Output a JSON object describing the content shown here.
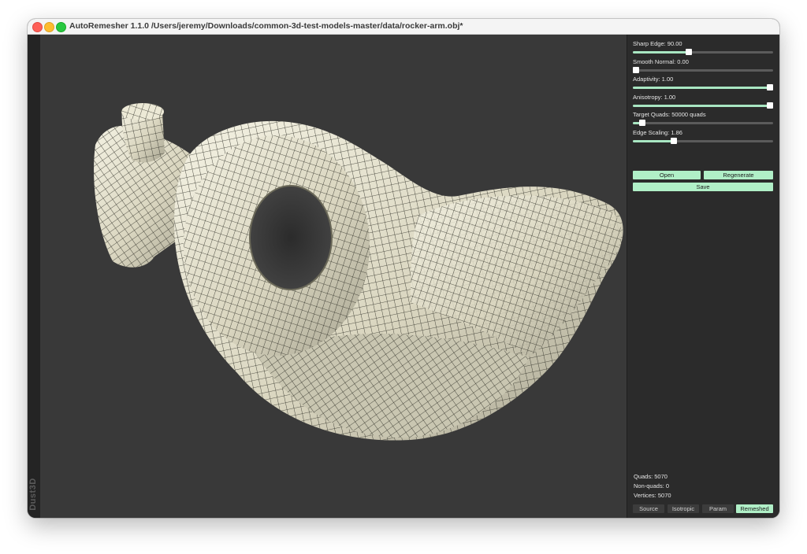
{
  "window": {
    "title": "AutoRemesher 1.1.0 /Users/jeremy/Downloads/common-3d-test-models-master/data/rocker-arm.obj*",
    "brand": "Dust3D"
  },
  "params": [
    {
      "label": "Sharp Edge: 90.00",
      "value": 0.4
    },
    {
      "label": "Smooth Normal: 0.00",
      "value": 0.0
    },
    {
      "label": "Adaptivity: 1.00",
      "value": 1.0
    },
    {
      "label": "Anisotropy: 1.00",
      "value": 1.0
    },
    {
      "label": "Target Quads: 50000 quads",
      "value": 0.07
    },
    {
      "label": "Edge Scaling: 1.86",
      "value": 0.29
    }
  ],
  "buttons": {
    "open": "Open",
    "regenerate": "Regenerate",
    "save": "Save"
  },
  "stats": {
    "quads": "Quads: 5070",
    "nonquads": "Non-quads: 0",
    "vertices": "Vertices: 5070"
  },
  "tabs": [
    {
      "label": "Source",
      "active": false
    },
    {
      "label": "Isotropic",
      "active": false
    },
    {
      "label": "Param",
      "active": false
    },
    {
      "label": "Remeshed",
      "active": true
    }
  ],
  "colors": {
    "accent": "#b0efc7",
    "mesh": "#e9e6d2",
    "wire": "#2a2a22",
    "viewport_bg": "#393939"
  }
}
